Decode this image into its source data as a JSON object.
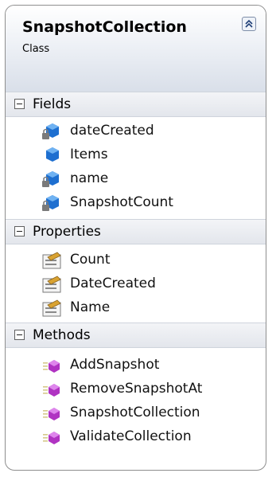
{
  "class_box": {
    "name": "SnapshotCollection",
    "kind": "Class",
    "sections": [
      {
        "title": "Fields",
        "members": [
          {
            "label": "dateCreated",
            "icon": "private-field-icon"
          },
          {
            "label": "Items",
            "icon": "public-field-icon"
          },
          {
            "label": "name",
            "icon": "private-field-icon"
          },
          {
            "label": "SnapshotCount",
            "icon": "private-field-icon"
          }
        ]
      },
      {
        "title": "Properties",
        "members": [
          {
            "label": "Count",
            "icon": "property-icon"
          },
          {
            "label": "DateCreated",
            "icon": "property-icon"
          },
          {
            "label": "Name",
            "icon": "property-icon"
          }
        ]
      },
      {
        "title": "Methods",
        "members": [
          {
            "label": "AddSnapshot",
            "icon": "method-icon"
          },
          {
            "label": "RemoveSnapshotAt",
            "icon": "method-icon"
          },
          {
            "label": "SnapshotCollection",
            "icon": "method-icon"
          },
          {
            "label": "ValidateCollection",
            "icon": "method-icon"
          }
        ]
      }
    ]
  },
  "colors": {
    "header_gradient_end": "#d9dfe9",
    "border": "#8e8e8e",
    "field_icon": "#1e6fd0",
    "method_icon": "#b033c2"
  }
}
